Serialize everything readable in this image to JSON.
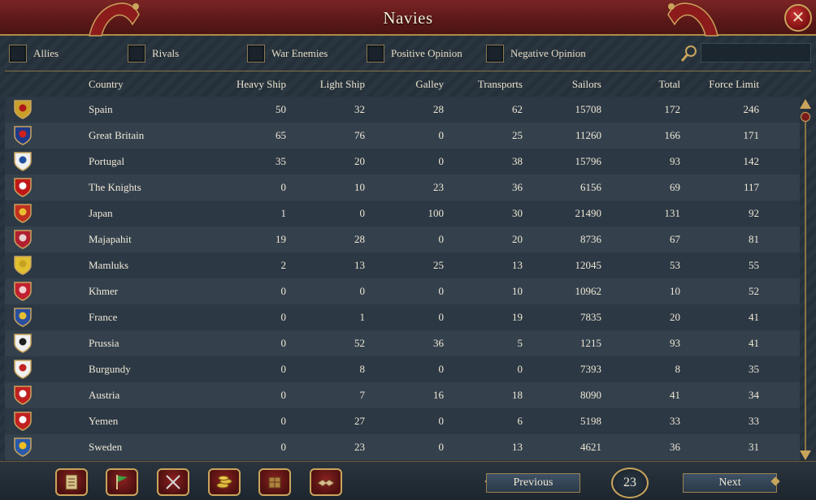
{
  "window": {
    "title": "Navies",
    "close_icon": "close-icon"
  },
  "filters": [
    {
      "label": "Allies"
    },
    {
      "label": "Rivals"
    },
    {
      "label": "War Enemies"
    },
    {
      "label": "Positive Opinion"
    },
    {
      "label": "Negative Opinion"
    }
  ],
  "search": {
    "placeholder": ""
  },
  "columns": [
    "Country",
    "Heavy Ship",
    "Light Ship",
    "Galley",
    "Transports",
    "Sailors",
    "Total",
    "Force Limit"
  ],
  "rows": [
    {
      "country": "Spain",
      "heavy": "50",
      "light": "32",
      "galley": "28",
      "transports": "62",
      "sailors": "15708",
      "total": "172",
      "limit": "246",
      "flag": "#c8a02a",
      "flag2": "#b01818"
    },
    {
      "country": "Great Britain",
      "heavy": "65",
      "light": "76",
      "galley": "0",
      "transports": "25",
      "sailors": "11260",
      "total": "166",
      "limit": "171",
      "flag": "#1f3a8a",
      "flag2": "#d02020"
    },
    {
      "country": "Portugal",
      "heavy": "35",
      "light": "20",
      "galley": "0",
      "transports": "38",
      "sailors": "15796",
      "total": "93",
      "limit": "142",
      "flag": "#f0f0f0",
      "flag2": "#2050a0"
    },
    {
      "country": "The Knights",
      "heavy": "0",
      "light": "10",
      "galley": "23",
      "transports": "36",
      "sailors": "6156",
      "total": "69",
      "limit": "117",
      "flag": "#c01818",
      "flag2": "#ffffff"
    },
    {
      "country": "Japan",
      "heavy": "1",
      "light": "0",
      "galley": "100",
      "transports": "30",
      "sailors": "21490",
      "total": "131",
      "limit": "92",
      "flag": "#c03020",
      "flag2": "#e8c030"
    },
    {
      "country": "Majapahit",
      "heavy": "19",
      "light": "28",
      "galley": "0",
      "transports": "20",
      "sailors": "8736",
      "total": "67",
      "limit": "81",
      "flag": "#b02030",
      "flag2": "#e8d0d0"
    },
    {
      "country": "Mamluks",
      "heavy": "2",
      "light": "13",
      "galley": "25",
      "transports": "13",
      "sailors": "12045",
      "total": "53",
      "limit": "55",
      "flag": "#e0c030",
      "flag2": "#c8a020"
    },
    {
      "country": "Khmer",
      "heavy": "0",
      "light": "0",
      "galley": "0",
      "transports": "10",
      "sailors": "10962",
      "total": "10",
      "limit": "52",
      "flag": "#c02030",
      "flag2": "#f0d0d0"
    },
    {
      "country": "France",
      "heavy": "0",
      "light": "1",
      "galley": "0",
      "transports": "19",
      "sailors": "7835",
      "total": "20",
      "limit": "41",
      "flag": "#2a4fa0",
      "flag2": "#e8c030"
    },
    {
      "country": "Prussia",
      "heavy": "0",
      "light": "52",
      "galley": "36",
      "transports": "5",
      "sailors": "1215",
      "total": "93",
      "limit": "41",
      "flag": "#f0f0f0",
      "flag2": "#202020"
    },
    {
      "country": "Burgundy",
      "heavy": "0",
      "light": "8",
      "galley": "0",
      "transports": "0",
      "sailors": "7393",
      "total": "8",
      "limit": "35",
      "flag": "#f0f0f0",
      "flag2": "#c02020"
    },
    {
      "country": "Austria",
      "heavy": "0",
      "light": "7",
      "galley": "16",
      "transports": "18",
      "sailors": "8090",
      "total": "41",
      "limit": "34",
      "flag": "#c02020",
      "flag2": "#ffffff"
    },
    {
      "country": "Yemen",
      "heavy": "0",
      "light": "27",
      "galley": "0",
      "transports": "6",
      "sailors": "5198",
      "total": "33",
      "limit": "33",
      "flag": "#c02020",
      "flag2": "#ffffff"
    },
    {
      "country": "Sweden",
      "heavy": "0",
      "light": "23",
      "galley": "0",
      "transports": "13",
      "sailors": "4621",
      "total": "36",
      "limit": "31",
      "flag": "#2a5aa8",
      "flag2": "#f0c020"
    }
  ],
  "bottom": {
    "nav_icons": [
      "ledger-icon",
      "flag-icon",
      "crossed-swords-icon",
      "coins-icon",
      "trade-crate-icon",
      "handshake-icon"
    ],
    "previous_label": "Previous",
    "next_label": "Next",
    "page_number": "23"
  },
  "colors": {
    "title_bar": "#6e2020",
    "accent_gold": "#c9a45c",
    "row_odd": "#2c3844",
    "row_even": "#34414d"
  }
}
